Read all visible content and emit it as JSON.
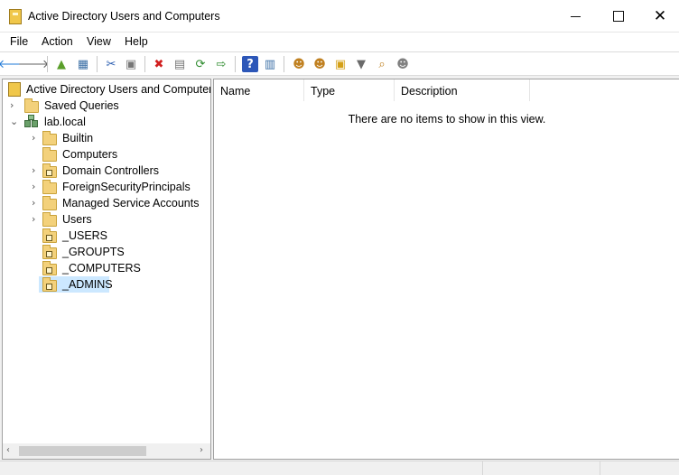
{
  "window": {
    "title": "Active Directory Users and Computers",
    "close_glyph": "✕"
  },
  "menu": [
    "File",
    "Action",
    "View",
    "Help"
  ],
  "toolbar": [
    {
      "icon": "back-arrow-icon",
      "glyph": "🡐",
      "color": "#1e78d7"
    },
    {
      "icon": "forward-arrow-icon",
      "glyph": "🡒",
      "color": "#606060"
    },
    {
      "icon": "up-folder-icon",
      "glyph": "▲",
      "color": "#5a9e2a"
    },
    {
      "icon": "show-hide-console-tree-icon",
      "glyph": "▦",
      "color": "#3a6ea5"
    },
    {
      "icon": "cut-icon",
      "glyph": "✂",
      "color": "#2a5db0"
    },
    {
      "icon": "copy-icon",
      "glyph": "▣",
      "color": "#777777"
    },
    {
      "icon": "delete-icon",
      "glyph": "✖",
      "color": "#d11f1f"
    },
    {
      "icon": "properties-icon",
      "glyph": "▤",
      "color": "#777777"
    },
    {
      "icon": "refresh-icon",
      "glyph": "⟳",
      "color": "#2e8b2e"
    },
    {
      "icon": "export-list-icon",
      "glyph": "⇨",
      "color": "#2e8b2e"
    },
    {
      "icon": "help-icon",
      "glyph": "?",
      "color": "#ffffff"
    },
    {
      "icon": "show-hide-action-pane-icon",
      "glyph": "▥",
      "color": "#3a6ea5"
    },
    {
      "icon": "create-user-icon",
      "glyph": "☻",
      "color": "#c08020"
    },
    {
      "icon": "create-group-icon",
      "glyph": "☻",
      "color": "#c08020"
    },
    {
      "icon": "create-ou-icon",
      "glyph": "▣",
      "color": "#d4a017"
    },
    {
      "icon": "filter-icon",
      "glyph": "▼",
      "color": "#6a6a6a"
    },
    {
      "icon": "find-icon",
      "glyph": "⌕",
      "color": "#c08020"
    },
    {
      "icon": "add-to-group-icon",
      "glyph": "☻",
      "color": "#808080"
    }
  ],
  "tree": {
    "root": "Active Directory Users and Computers",
    "items": [
      {
        "label": "Saved Queries",
        "level": 1,
        "expander": "›",
        "icon": "folder"
      },
      {
        "label": "lab.local",
        "level": 1,
        "expander": "⌄",
        "icon": "domain"
      },
      {
        "label": "Builtin",
        "level": 2,
        "expander": "›",
        "icon": "folder"
      },
      {
        "label": "Computers",
        "level": 2,
        "expander": "",
        "icon": "folder"
      },
      {
        "label": "Domain Controllers",
        "level": 2,
        "expander": "›",
        "icon": "ou"
      },
      {
        "label": "ForeignSecurityPrincipals",
        "level": 2,
        "expander": "›",
        "icon": "folder"
      },
      {
        "label": "Managed Service Accounts",
        "level": 2,
        "expander": "›",
        "icon": "folder"
      },
      {
        "label": "Users",
        "level": 2,
        "expander": "›",
        "icon": "folder"
      },
      {
        "label": "_USERS",
        "level": 2,
        "expander": "",
        "icon": "ou"
      },
      {
        "label": "_GROUPTS",
        "level": 2,
        "expander": "",
        "icon": "ou"
      },
      {
        "label": "_COMPUTERS",
        "level": 2,
        "expander": "",
        "icon": "ou"
      },
      {
        "label": "_ADMINS",
        "level": 2,
        "expander": "",
        "icon": "ou",
        "selected": true
      }
    ],
    "scroll_left": "‹",
    "scroll_right": "›"
  },
  "list": {
    "columns": [
      "Name",
      "Type",
      "Description"
    ],
    "empty_message": "There are no items to show in this view."
  },
  "colors": {
    "selection": "#cce8ff",
    "folder": "#f3d17b"
  }
}
